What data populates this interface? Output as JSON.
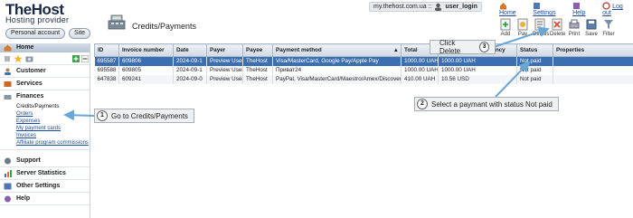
{
  "brand": {
    "title": "TheHost",
    "subtitle": "Hosting provider"
  },
  "header_buttons": {
    "personal": "Personal account",
    "site": "Site"
  },
  "page": {
    "title": "Credits/Payments"
  },
  "top": {
    "site": "my.thehost.com.ua ::",
    "user": "user_login",
    "home": "Home",
    "settings": "Settings",
    "help": "Help",
    "logout": "Log out"
  },
  "toolbar": {
    "add": "Add",
    "pay": "Pay",
    "details": "Details",
    "delete": "Delete",
    "print": "Print",
    "save": "Save",
    "filter": "Filter"
  },
  "menu": {
    "home": "Home",
    "customer": "Customer",
    "services": "Services",
    "finances": "Finances",
    "sub": [
      "Credits/Payments",
      "Orders",
      "Expenses",
      "My payment cards",
      "Invoices",
      "Affiliate program commissions"
    ],
    "support": "Support",
    "server_statistics": "Server Statistics",
    "other_settings": "Other Settings",
    "help": "Help"
  },
  "table": {
    "headers": [
      "ID",
      "Invoice number",
      "Date",
      "Payer",
      "Payee",
      "Payment method",
      "Total",
      "Amount in the currency",
      "Status",
      "Properties"
    ],
    "rows": [
      [
        "695587",
        "609806",
        "2024-09-1",
        "Preview User",
        "TheHost",
        "Visa/MasterCard, Google Pay/Apple Pay",
        "1000.00 UAH",
        "1000.00 UAH",
        "Not paid",
        ""
      ],
      [
        "695588",
        "609805",
        "2024-09-1",
        "Preview User",
        "TheHost",
        "Приват24",
        "1000.00 UAH",
        "1000.00 UAH",
        "Not paid",
        ""
      ],
      [
        "647838",
        "609241",
        "2024-09-0",
        "Preview User",
        "TheHost",
        "PayPal, Visa/MasterCard/Maestro/Amex/Discover",
        "410.00 UAH",
        "10.56 USD",
        "Not paid",
        ""
      ]
    ]
  },
  "callouts": {
    "c1": {
      "n": "1",
      "text": "Go to Credits/Payments"
    },
    "c2": {
      "n": "2",
      "text": "Select a paymant with status Not paid"
    },
    "c3": {
      "n": "3",
      "text": "Click Delete"
    }
  },
  "colors": {
    "selected_row": "#3b6fb2",
    "arrow": "#6aa6d8"
  }
}
